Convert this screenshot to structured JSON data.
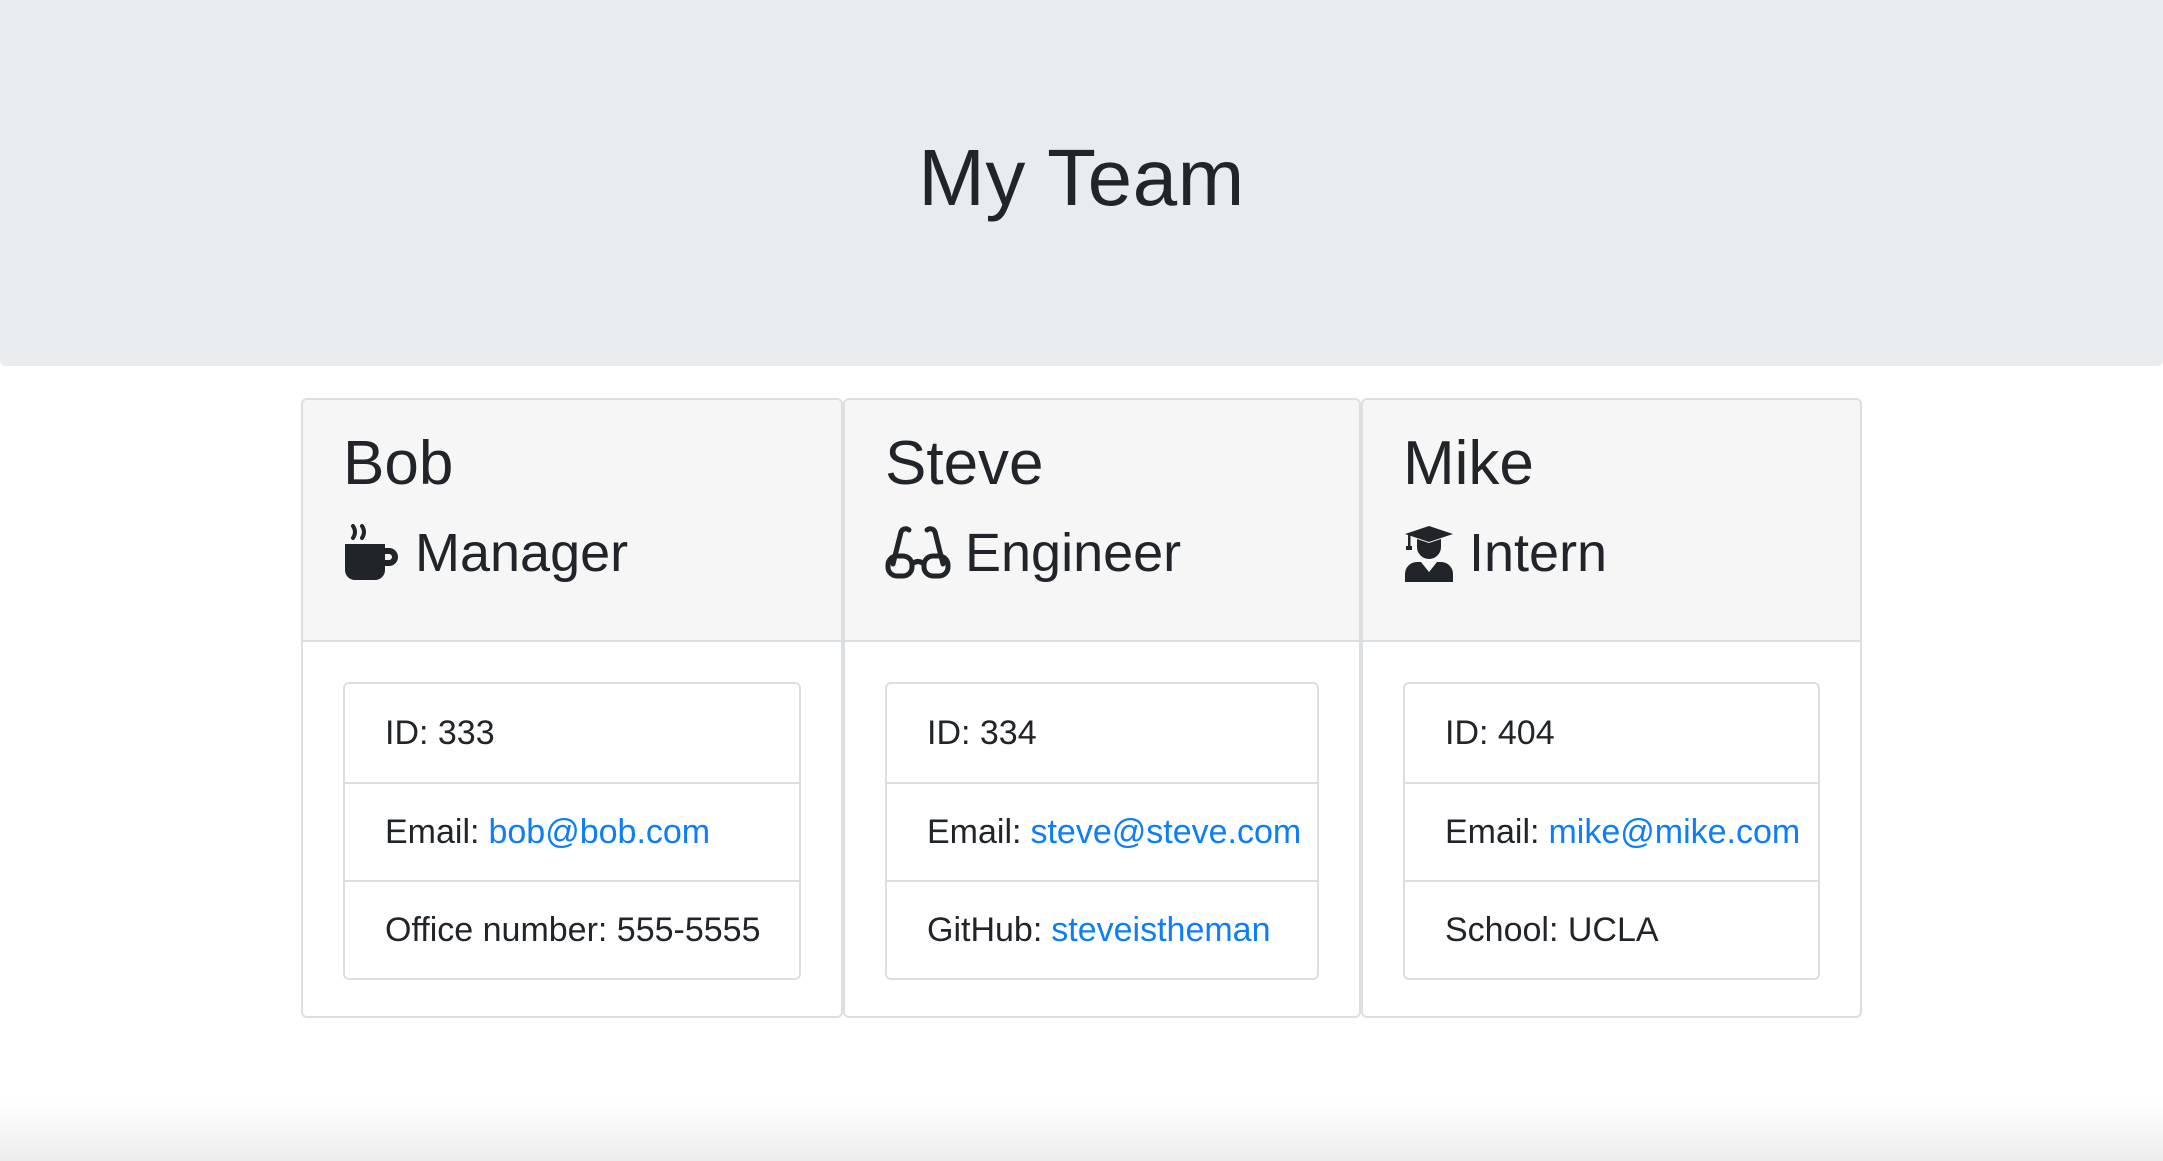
{
  "header": {
    "title": "My Team"
  },
  "employees": [
    {
      "name": "Bob",
      "role": "Manager",
      "role_icon": "coffee-icon",
      "id_label": "ID: 333",
      "email_label": "Email:",
      "email": "bob@bob.com",
      "extra_label": "Office number: 555-5555"
    },
    {
      "name": "Steve",
      "role": "Engineer",
      "role_icon": "glasses-icon",
      "id_label": "ID: 334",
      "email_label": "Email:",
      "email": "steve@steve.com",
      "extra_label": "GitHub:",
      "extra_link": "steveistheman"
    },
    {
      "name": "Mike",
      "role": "Intern",
      "role_icon": "graduate-icon",
      "id_label": "ID: 404",
      "email_label": "Email:",
      "email": "mike@mike.com",
      "extra_label": "School: UCLA"
    }
  ],
  "colors": {
    "jumbotron_bg": "#e9ecef",
    "link": "#0d7ef7",
    "header_bg": "#f6f6f6"
  }
}
